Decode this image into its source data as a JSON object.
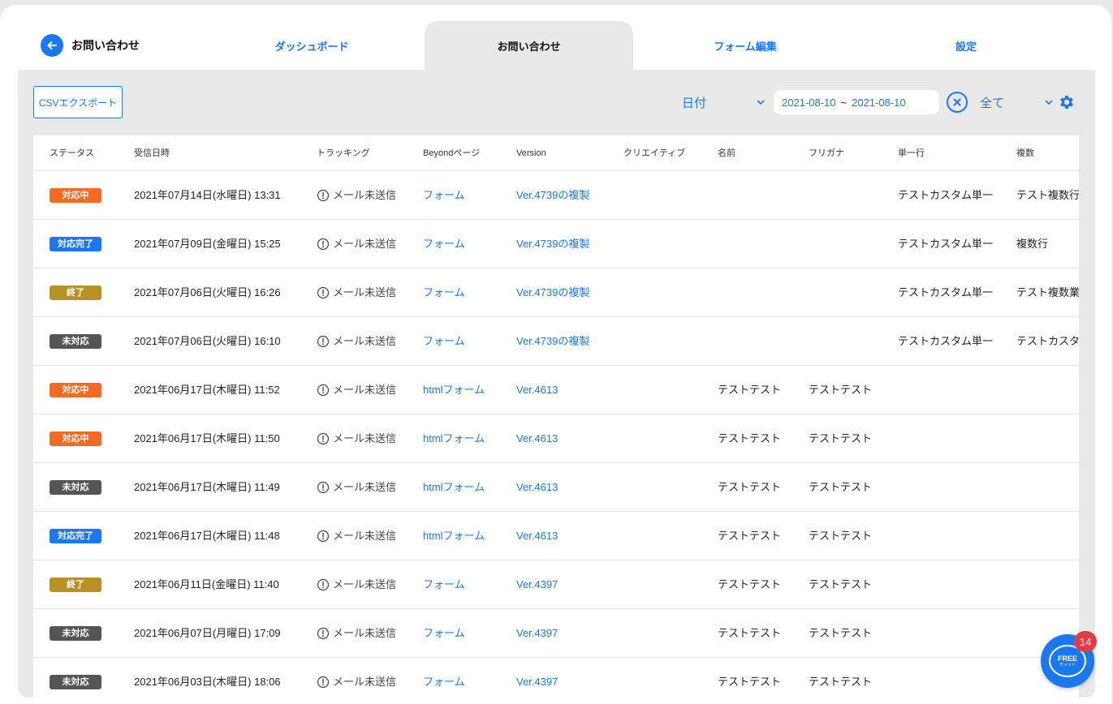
{
  "header": {
    "back_title": "お問い合わせ",
    "tabs": [
      {
        "label": "ダッシュボード",
        "active": false
      },
      {
        "label": "お問い合わせ",
        "active": true
      },
      {
        "label": "フォーム編集",
        "active": false
      },
      {
        "label": "設定",
        "active": false
      }
    ]
  },
  "toolbar": {
    "csv_label": "CSVエクスポート",
    "date_select": "日付",
    "range_start": "2021-08-10",
    "range_sep": "~",
    "range_end": "2021-08-10",
    "filter_select": "全て"
  },
  "colors": {
    "accent": "#1a78f2",
    "status_in_progress": "#f56a22",
    "status_done": "#1a78f2",
    "status_closed": "#b89123",
    "status_unhandled": "#555555"
  },
  "table": {
    "headers": [
      "ステータス",
      "受信日時",
      "トラッキング",
      "Beyondページ",
      "Version",
      "クリエイティブ",
      "名前",
      "フリガナ",
      "単一行",
      "複数"
    ],
    "rows": [
      {
        "status": "対応中",
        "type": "in_progress",
        "date": "2021年07月14日(水曜日) 13:31",
        "tracking": "メール未送信",
        "page": "フォーム",
        "version": "Ver.4739の複製",
        "creative": "",
        "name": "",
        "kana": "",
        "single": "テストカスタム単一",
        "multi": "テスト複数行"
      },
      {
        "status": "対応完了",
        "type": "done",
        "date": "2021年07月09日(金曜日) 15:25",
        "tracking": "メール未送信",
        "page": "フォーム",
        "version": "Ver.4739の複製",
        "creative": "",
        "name": "",
        "kana": "",
        "single": "テストカスタム単一",
        "multi": "複数行"
      },
      {
        "status": "終了",
        "type": "closed",
        "date": "2021年07月06日(火曜日) 16:26",
        "tracking": "メール未送信",
        "page": "フォーム",
        "version": "Ver.4739の複製",
        "creative": "",
        "name": "",
        "kana": "",
        "single": "テストカスタム単一",
        "multi": "テスト複数業"
      },
      {
        "status": "未対応",
        "type": "unhandled",
        "date": "2021年07月06日(火曜日) 16:10",
        "tracking": "メール未送信",
        "page": "フォーム",
        "version": "Ver.4739の複製",
        "creative": "",
        "name": "",
        "kana": "",
        "single": "テストカスタム単一",
        "multi": "テストカスタム"
      },
      {
        "status": "対応中",
        "type": "in_progress",
        "date": "2021年06月17日(木曜日) 11:52",
        "tracking": "メール未送信",
        "page": "htmlフォーム",
        "version": "Ver.4613",
        "creative": "",
        "name": "テストテスト",
        "kana": "テストテスト",
        "single": "",
        "multi": ""
      },
      {
        "status": "対応中",
        "type": "in_progress",
        "date": "2021年06月17日(木曜日) 11:50",
        "tracking": "メール未送信",
        "page": "htmlフォーム",
        "version": "Ver.4613",
        "creative": "",
        "name": "テストテスト",
        "kana": "テストテスト",
        "single": "",
        "multi": ""
      },
      {
        "status": "未対応",
        "type": "unhandled",
        "date": "2021年06月17日(木曜日) 11:49",
        "tracking": "メール未送信",
        "page": "htmlフォーム",
        "version": "Ver.4613",
        "creative": "",
        "name": "テストテスト",
        "kana": "テストテスト",
        "single": "",
        "multi": ""
      },
      {
        "status": "対応完了",
        "type": "done",
        "date": "2021年06月17日(木曜日) 11:48",
        "tracking": "メール未送信",
        "page": "htmlフォーム",
        "version": "Ver.4613",
        "creative": "",
        "name": "テストテスト",
        "kana": "テストテスト",
        "single": "",
        "multi": ""
      },
      {
        "status": "終了",
        "type": "closed",
        "date": "2021年06月11日(金曜日) 11:40",
        "tracking": "メール未送信",
        "page": "フォーム",
        "version": "Ver.4397",
        "creative": "",
        "name": "テストテスト",
        "kana": "テストテスト",
        "single": "",
        "multi": ""
      },
      {
        "status": "未対応",
        "type": "unhandled",
        "date": "2021年06月07日(月曜日) 17:09",
        "tracking": "メール未送信",
        "page": "フォーム",
        "version": "Ver.4397",
        "creative": "",
        "name": "テストテスト",
        "kana": "テストテスト",
        "single": "",
        "multi": ""
      },
      {
        "status": "未対応",
        "type": "unhandled",
        "date": "2021年06月03日(木曜日) 18:06",
        "tracking": "メール未送信",
        "page": "フォーム",
        "version": "Ver.4397",
        "creative": "",
        "name": "テストテスト",
        "kana": "テストテスト",
        "single": "",
        "multi": ""
      }
    ]
  },
  "chat": {
    "label": "FREE",
    "sublabel": "チャット",
    "count": "14"
  }
}
